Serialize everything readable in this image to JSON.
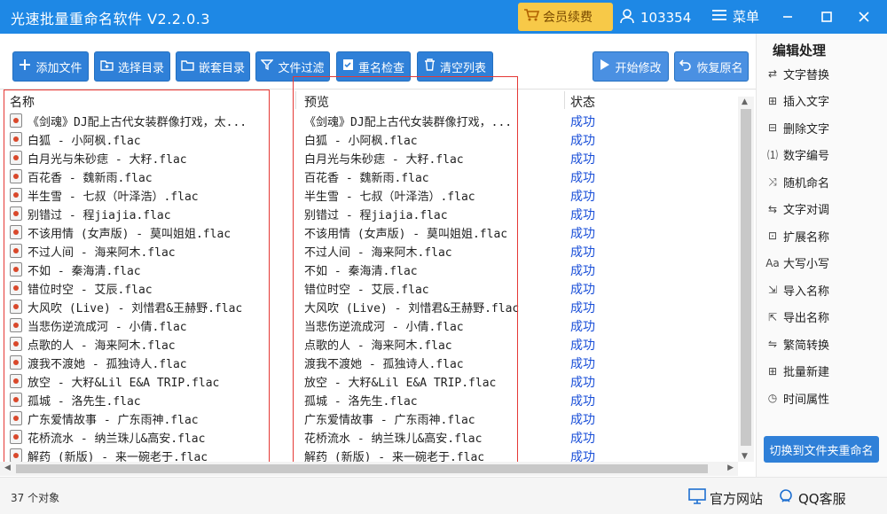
{
  "titlebar": {
    "title": "光速批量重命名软件 V2.2.0.3",
    "vip_label": "会员续费",
    "user_id": "103354",
    "menu_label": "菜单"
  },
  "toolbar": {
    "add_file": "添加文件",
    "select_dir": "选择目录",
    "nested_dir": "嵌套目录",
    "file_filter": "文件过滤",
    "dup_check": "重名检查",
    "clear_list": "清空列表",
    "start": "开始修改",
    "restore": "恢复原名"
  },
  "columns": {
    "name": "名称",
    "preview": "预览",
    "status": "状态"
  },
  "rows": [
    {
      "name": "《剑魂》DJ配上古代女装群像打戏，太...",
      "preview": "《剑魂》DJ配上古代女装群像打戏，...",
      "status": "成功"
    },
    {
      "name": "白狐 - 小阿枫.flac",
      "preview": "白狐 - 小阿枫.flac",
      "status": "成功"
    },
    {
      "name": "白月光与朱砂痣 - 大籽.flac",
      "preview": "白月光与朱砂痣 - 大籽.flac",
      "status": "成功"
    },
    {
      "name": "百花香 - 魏新雨.flac",
      "preview": "百花香 - 魏新雨.flac",
      "status": "成功"
    },
    {
      "name": "半生雪 - 七叔（叶泽浩）.flac",
      "preview": "半生雪 - 七叔（叶泽浩）.flac",
      "status": "成功"
    },
    {
      "name": "别错过 - 程jiajia.flac",
      "preview": "别错过 - 程jiajia.flac",
      "status": "成功"
    },
    {
      "name": "不该用情 (女声版) - 莫叫姐姐.flac",
      "preview": "不该用情 (女声版) - 莫叫姐姐.flac",
      "status": "成功"
    },
    {
      "name": "不过人间 - 海来阿木.flac",
      "preview": "不过人间 - 海来阿木.flac",
      "status": "成功"
    },
    {
      "name": "不如 - 秦海清.flac",
      "preview": "不如 - 秦海清.flac",
      "status": "成功"
    },
    {
      "name": "错位时空 - 艾辰.flac",
      "preview": "错位时空 - 艾辰.flac",
      "status": "成功"
    },
    {
      "name": "大风吹 (Live) - 刘惜君&王赫野.flac",
      "preview": "大风吹 (Live) - 刘惜君&王赫野.flac",
      "status": "成功"
    },
    {
      "name": "当悲伤逆流成河 - 小倩.flac",
      "preview": "当悲伤逆流成河 - 小倩.flac",
      "status": "成功"
    },
    {
      "name": "点歌的人 - 海来阿木.flac",
      "preview": "点歌的人 - 海来阿木.flac",
      "status": "成功"
    },
    {
      "name": "渡我不渡她 - 孤独诗人.flac",
      "preview": "渡我不渡她 - 孤独诗人.flac",
      "status": "成功"
    },
    {
      "name": "放空 - 大籽&Lil E&A TRIP.flac",
      "preview": "放空 - 大籽&Lil E&A TRIP.flac",
      "status": "成功"
    },
    {
      "name": "孤城 - 洛先生.flac",
      "preview": "孤城 - 洛先生.flac",
      "status": "成功"
    },
    {
      "name": "广东爱情故事 - 广东雨神.flac",
      "preview": "广东爱情故事 - 广东雨神.flac",
      "status": "成功"
    },
    {
      "name": "花桥流水 - 纳兰珠儿&高安.flac",
      "preview": "花桥流水 - 纳兰珠儿&高安.flac",
      "status": "成功"
    },
    {
      "name": "解药 (新版) - 来一碗老于.flac",
      "preview": "解药 (新版) - 来一碗老于.flac",
      "status": "成功"
    }
  ],
  "statusbar": {
    "count": "37 个对象",
    "website": "官方网站",
    "qq": "QQ客服"
  },
  "rpanel": {
    "title": "编辑处理",
    "items": [
      "文字替换",
      "插入文字",
      "删除文字",
      "数字编号",
      "随机命名",
      "文字对调",
      "扩展名称",
      "大写小写",
      "导入名称",
      "导出名称",
      "繁简转换",
      "批量新建",
      "时间属性"
    ],
    "switch": "切换到文件夹重命名"
  },
  "colors": {
    "titlebar": "#1e88e5",
    "button": "#2f80d8",
    "success": "#1a4fd8",
    "highlight": "#e53935",
    "vip": "#f7c948"
  }
}
